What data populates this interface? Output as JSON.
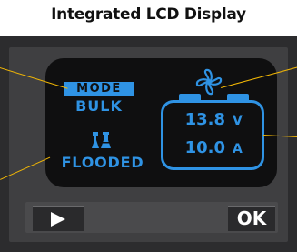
{
  "title": "Integrated LCD Display",
  "display": {
    "mode_label": "MODE",
    "mode_value": "BULK",
    "battery_type": "FLOODED",
    "voltage": {
      "value": "13.8",
      "unit": "V"
    },
    "current": {
      "value": "10.0",
      "unit": "A"
    },
    "accent_color": "#2f93e4"
  },
  "buttons": {
    "play_icon": "play-icon",
    "ok_label": "OK"
  },
  "icons": {
    "fan": "fan-icon",
    "battery_type": "flask-icon"
  },
  "colors": {
    "callout": "#f2b705",
    "bezel": "#2c2c2e"
  }
}
